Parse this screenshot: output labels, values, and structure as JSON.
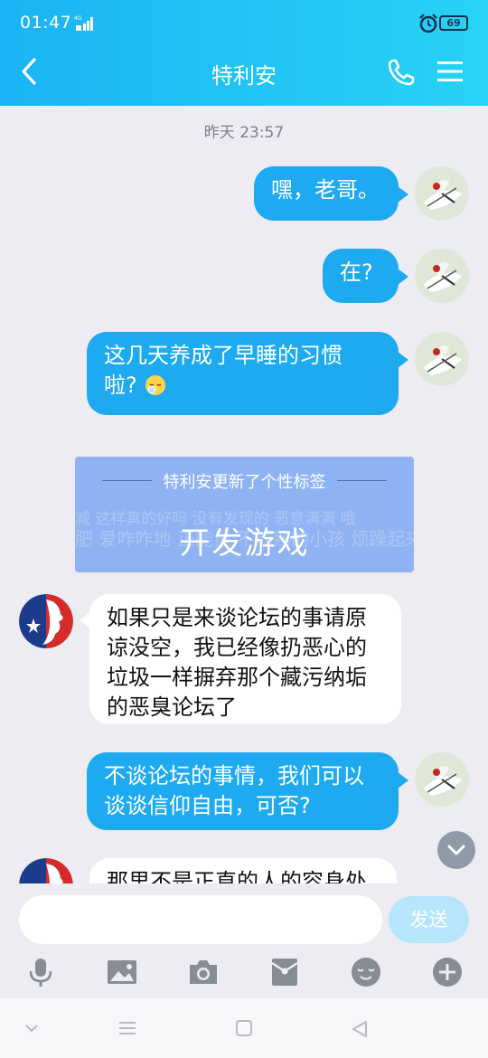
{
  "status_bar": {
    "time": "01:47",
    "network": "4G",
    "battery": "69"
  },
  "header": {
    "title": "特利安"
  },
  "chat": {
    "timestamp": "昨天 23:57",
    "messages": [
      {
        "side": "out",
        "text": "嘿，老哥。"
      },
      {
        "side": "out",
        "text": "在?"
      },
      {
        "side": "out",
        "line1": "这几天养成了早睡的习惯",
        "line2": "啦?",
        "emoji": "sleepy-face-emoji"
      },
      {
        "side": "in",
        "lines": [
          "如果只是来谈论坛的事请原",
          "谅没空，我已经像扔恶心的",
          "垃圾一样摒弃那个藏污纳垢",
          "的恶臭论坛了"
        ]
      },
      {
        "side": "out",
        "lines": [
          "不谈论坛的事情，我们可以",
          "谈谈信仰自由，可否?"
        ]
      },
      {
        "side": "in",
        "text": "那里不是正直的人的容身处"
      }
    ],
    "signature_card": {
      "header": "特利安更新了个性标签",
      "tag": "开发游戏",
      "background_text": [
        "减 这样真的好吗  没有发现的  恶意满满  哦",
        "肥 爱咋咋地  正能量  不成熟的小孩  烦躁起来"
      ]
    }
  },
  "input_bar": {
    "placeholder": "",
    "send_label": "发送"
  },
  "colors": {
    "header_start": "#1ab4f6",
    "header_end": "#27d3f5",
    "bubble_out": "#1eaaf0",
    "background": "#ececf2"
  }
}
